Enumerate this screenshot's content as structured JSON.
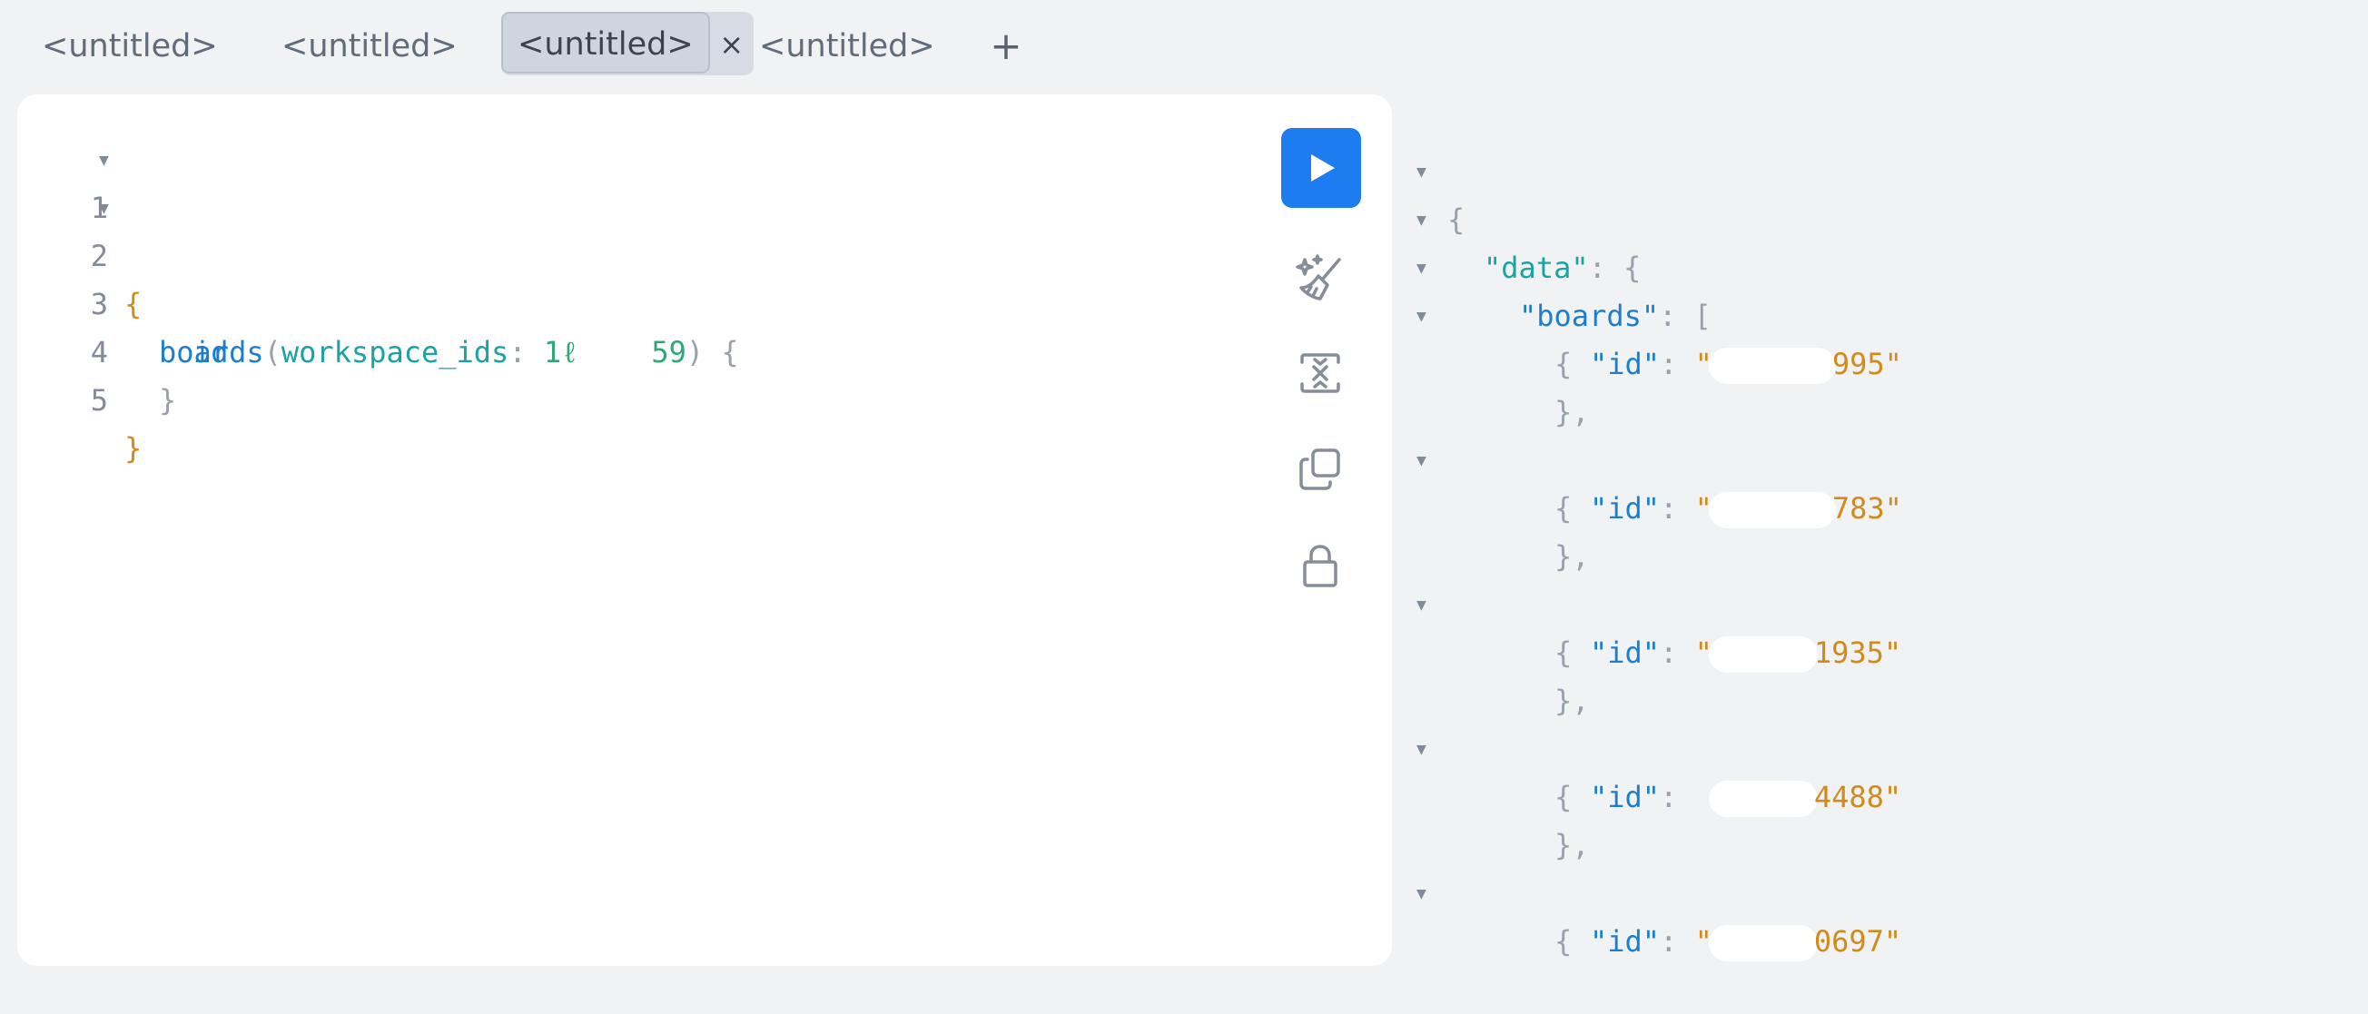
{
  "tabs": [
    {
      "label": "<untitled>"
    },
    {
      "label": "<untitled>"
    },
    {
      "label": "<untitled>",
      "close": "×"
    },
    {
      "label": "<untitled>"
    }
  ],
  "add_tab": "+",
  "editor": {
    "lines": [
      {
        "n": "1",
        "open": "{"
      },
      {
        "n": "2",
        "field": "boards",
        "lparen": "(",
        "arg": "workspace_ids",
        "colon": ":",
        "val_a": "1ℓ",
        "val_b": "59",
        "rparen": ")",
        "brace": "{"
      },
      {
        "n": "3",
        "field": "id"
      },
      {
        "n": "4",
        "close": "}"
      },
      {
        "n": "5",
        "close": "}"
      }
    ]
  },
  "toolbar": {
    "run_icon": "play-icon",
    "prettify_icon": "magic-brush-icon",
    "merge_icon": "merge-fragments-icon",
    "copy_icon": "copy-icon",
    "lock_icon": "lock-icon"
  },
  "result": {
    "open": "{",
    "data_key": "\"data\"",
    "boards_key": "\"boards\"",
    "colon": ":",
    "obj_open": "{",
    "arr_open": "[",
    "obj_close": "},",
    "id_key": "\"id\"",
    "items": [
      {
        "id_suffix": "995\""
      },
      {
        "id_suffix": "783\""
      },
      {
        "id_suffix": "1935\""
      },
      {
        "id_suffix": "4488\""
      },
      {
        "id_suffix": "0697\""
      }
    ],
    "quote": "\""
  },
  "colors": {
    "accent": "#1c7cf0",
    "key": "#1c7fce",
    "string": "#d18b1a",
    "argument": "#1ba3a3",
    "number": "#2fa877"
  }
}
